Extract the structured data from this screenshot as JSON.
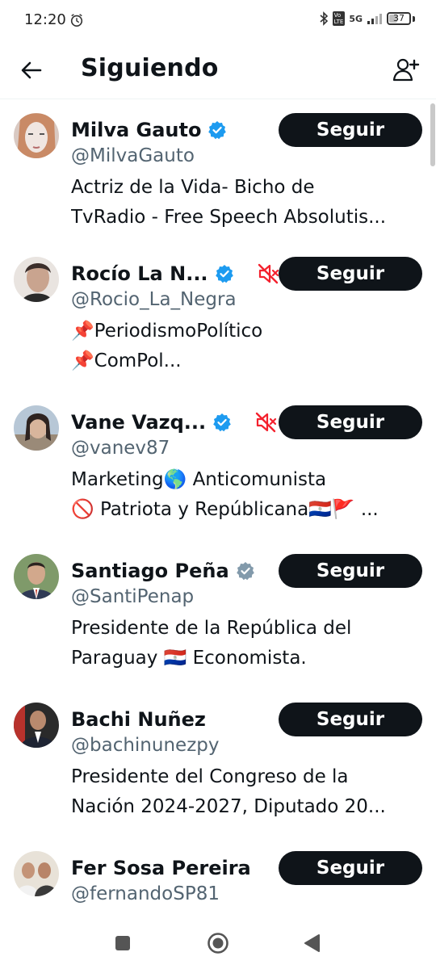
{
  "status_bar": {
    "time": "12:20",
    "network": "5G",
    "battery_level": "37",
    "icons": [
      "alarm-icon",
      "bluetooth-icon",
      "volte-icon",
      "signal-icon",
      "battery-icon"
    ]
  },
  "header": {
    "title": "Siguiendo",
    "back_icon": "arrow-left-icon",
    "add_icon": "add-user-icon"
  },
  "colors": {
    "text": "#0f1419",
    "secondary_text": "#536471",
    "verified_blue": "#1d9bf0",
    "verified_gray": "#829aab",
    "muted_red": "#f4212e",
    "button_bg": "#0f1419"
  },
  "following": [
    {
      "name": "Milva Gauto",
      "handle": "@MilvaGauto",
      "verified": "blue",
      "muted": false,
      "bio": [
        "Actriz de la Vida- Bicho de",
        "TvRadio - Free Speech Absolutis..."
      ],
      "button": "Seguir"
    },
    {
      "name": "Rocío La N...",
      "handle": "@Rocio_La_Negra",
      "verified": "blue",
      "muted": true,
      "bio": [
        "📌PeriodismoPolítico",
        "📌ComPol..."
      ],
      "button": "Seguir"
    },
    {
      "name": "Vane Vazq...",
      "handle": "@vanev87",
      "verified": "blue",
      "muted": true,
      "bio": [
        "Marketing🌎 Anticomunista",
        "🚫 Patriota y Repúblicana🇵🇾🚩 ..."
      ],
      "button": "Seguir"
    },
    {
      "name": "Santiago Peña",
      "handle": "@SantiPenap",
      "verified": "gray",
      "muted": false,
      "bio": [
        "Presidente de la República del",
        "Paraguay 🇵🇾 Economista."
      ],
      "button": "Seguir"
    },
    {
      "name": "Bachi Nuñez",
      "handle": "@bachinunezpy",
      "verified": "none",
      "muted": false,
      "bio": [
        "Presidente del Congreso de la",
        "Nación 2024-2027, Diputado 20..."
      ],
      "button": "Seguir"
    },
    {
      "name": "Fer Sosa Pereira",
      "handle": "@fernandoSP81",
      "verified": "none",
      "muted": false,
      "bio": [],
      "button": "Seguir"
    }
  ],
  "nav_bar": {
    "icons": [
      "recents-square-icon",
      "home-circle-icon",
      "back-triangle-icon"
    ]
  }
}
